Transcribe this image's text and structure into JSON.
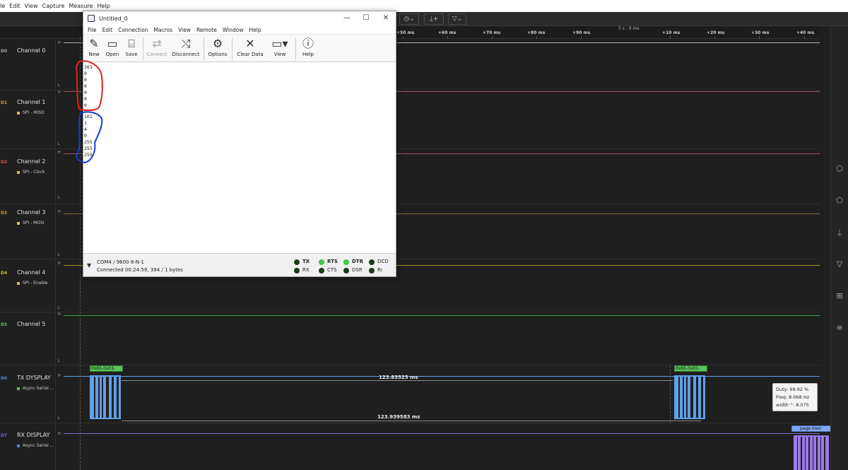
{
  "la_menu": [
    "le",
    "Edit",
    "View",
    "Capture",
    "Measure",
    "Help"
  ],
  "ruler": {
    "ticks": [
      "+50 ms",
      "+60 ms",
      "+70 ms",
      "+80 ms",
      "+90 ms",
      "+10 ms",
      "+20 ms",
      "+30 ms",
      "+40 ms"
    ],
    "center_label": "5 s : 0 ms"
  },
  "channels": [
    {
      "num": "D0",
      "name": "Channel 0",
      "sub": "",
      "color": "#aaaaaa",
      "wave_color": "#bbbbbb"
    },
    {
      "num": "D1",
      "name": "Channel 1",
      "sub": "SPI - MISO",
      "color": "#d9904a",
      "wave_color": "#b05050"
    },
    {
      "num": "D2",
      "name": "Channel 2",
      "sub": "SPI - Clock",
      "color": "#e05050",
      "wave_color": "#c05060"
    },
    {
      "num": "D3",
      "name": "Channel 3",
      "sub": "SPI - MOSI",
      "color": "#d0a030",
      "wave_color": "#a07030"
    },
    {
      "num": "D4",
      "name": "Channel 4",
      "sub": "SPI - Enable",
      "color": "#d0c030",
      "wave_color": "#b0a030"
    },
    {
      "num": "D5",
      "name": "Channel 5",
      "sub": "",
      "color": "#60c060",
      "wave_color": "#40a040"
    },
    {
      "num": "D6",
      "name": "TX DYSPLAY",
      "sub": "Async Serial ...",
      "color": "#4a8ae0",
      "wave_color": "#5fa0e8"
    },
    {
      "num": "D7",
      "name": "RX DISPLAY",
      "sub": "Async Serial ...",
      "color": "#8060e0",
      "wave_color": "#8a70e0"
    }
  ],
  "hl": {
    "high": "H",
    "low": "L"
  },
  "tx_proto": {
    "label1": "0x65-0x01-",
    "label2": "0x65-0x01-"
  },
  "rx_proto": {
    "label": "page men"
  },
  "measurements": {
    "span1": "123.83525 ms",
    "span2": "123.939583 ms"
  },
  "tooltip": {
    "duty": "Duty: 99.92 %",
    "freq": "Freq: 8.068 Hz",
    "width": "width⁻¹: 8.075 Hz"
  },
  "terminal": {
    "title": "Untitled_0",
    "menu": [
      "File",
      "Edit",
      "Connection",
      "Macros",
      "View",
      "Remote",
      "Window",
      "Help"
    ],
    "toolbar": {
      "new": "New",
      "open": "Open",
      "save": "Save",
      "connect": "Connect",
      "disconnect": "Disconnect",
      "options": "Options",
      "clear": "Clear Data",
      "view": "View",
      "help": "Help"
    },
    "rx_lines": [
      "101",
      "0",
      "0",
      "0",
      "0",
      "0",
      "0",
      "0",
      "101",
      "1",
      "4",
      "0",
      "255",
      "255",
      "255"
    ],
    "status": {
      "port": "COM4 / 9600 8-N-1",
      "connected": "Connected 00:24:59, 394 / 1 bytes"
    },
    "leds": [
      {
        "label": "TX",
        "state": "off"
      },
      {
        "label": "RX",
        "state": "off"
      },
      {
        "label": "RTS",
        "state": "on"
      },
      {
        "label": "CTS",
        "state": "off"
      },
      {
        "label": "DTR",
        "state": "on"
      },
      {
        "label": "DSR",
        "state": "off"
      },
      {
        "label": "DCD",
        "state": "off"
      },
      {
        "label": "RI",
        "state": "off"
      }
    ]
  },
  "colors": {
    "led_on": "#3ecb3e",
    "led_off": "#1e3a1e",
    "annot_red": "#e02020",
    "annot_blue": "#1040d0"
  }
}
